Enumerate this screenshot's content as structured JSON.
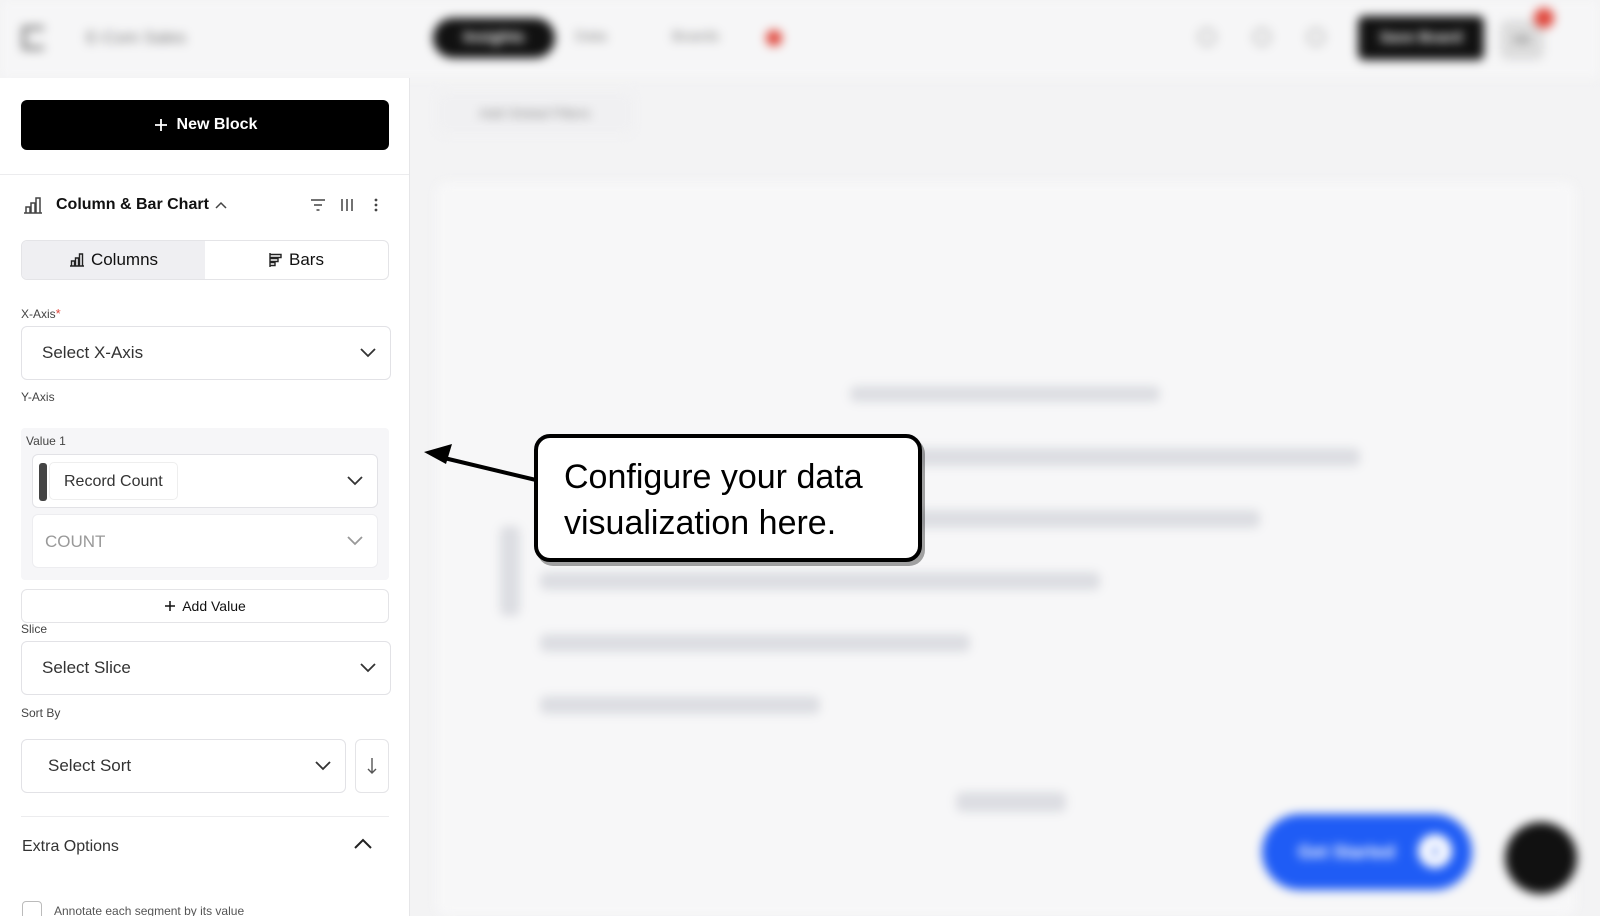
{
  "app": {
    "title": "E-Com Sales",
    "nav": {
      "insights": "Insights",
      "data": "Data",
      "boards": "Boards"
    },
    "save_board": "Save Board",
    "avatar_initials": "HK",
    "add_global_filters": "Add Global Filters",
    "get_started": "Get Started",
    "get_started_count": "2"
  },
  "sidebar": {
    "new_block_label": "New Block",
    "chart_type_title": "Column & Bar Chart",
    "orientation_tabs": [
      {
        "label": "Columns",
        "active": true
      },
      {
        "label": "Bars",
        "active": false
      }
    ],
    "x_axis": {
      "label": "X-Axis",
      "required_mark": "*",
      "placeholder": "Select X-Axis"
    },
    "y_axis": {
      "label": "Y-Axis",
      "value1_label": "Value 1",
      "value1_field": "Record Count",
      "value1_agg": "COUNT"
    },
    "add_value_label": "Add Value",
    "slice": {
      "label": "Slice",
      "placeholder": "Select Slice"
    },
    "sort_by": {
      "label": "Sort By",
      "placeholder": "Select Sort"
    },
    "extra_options_title": "Extra Options",
    "annotate_label": "Annotate each segment by its value"
  },
  "callout": {
    "text_line1": "Configure your data",
    "text_line2": "visualization here."
  },
  "colors": {
    "primary_button": "#000000",
    "get_started": "#1f5cf5",
    "badge": "#e0453a",
    "required": "#e0453a"
  }
}
